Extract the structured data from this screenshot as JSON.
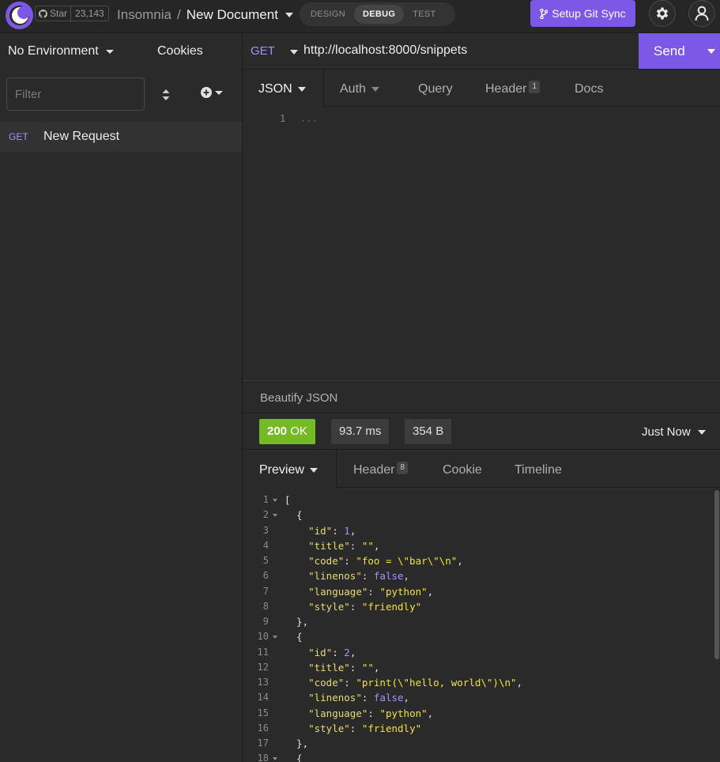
{
  "app": {
    "github_star_label": "Star",
    "github_star_count": "23,143",
    "breadcrumb_app": "Insomnia",
    "breadcrumb_separator": "/",
    "breadcrumb_document": "New Document",
    "modes": [
      "DESIGN",
      "DEBUG",
      "TEST"
    ],
    "active_mode": "DEBUG",
    "git_sync_label": "Setup Git Sync",
    "accent_color": "#7b59e6"
  },
  "sidebar": {
    "environment_label": "No Environment",
    "cookies_label": "Cookies",
    "filter_placeholder": "Filter",
    "requests": [
      {
        "method": "GET",
        "name": "New Request"
      }
    ]
  },
  "request": {
    "method": "GET",
    "url": "http://localhost:8000/snippets",
    "send_label": "Send",
    "tabs": {
      "body": "JSON",
      "auth": "Auth",
      "query": "Query",
      "header": "Header",
      "header_count": "1",
      "docs": "Docs"
    },
    "editor_line_number": "1",
    "editor_placeholder": "...",
    "beautify_label": "Beautify JSON"
  },
  "response": {
    "status_code": "200",
    "status_text": "OK",
    "time": "93.7 ms",
    "size": "354 B",
    "history_label": "Just Now",
    "status_color": "#75ba24",
    "tabs": {
      "preview": "Preview",
      "header": "Header",
      "header_count": "8",
      "cookie": "Cookie",
      "timeline": "Timeline"
    },
    "lines": [
      {
        "no": "1",
        "fold": true,
        "text": "["
      },
      {
        "no": "2",
        "fold": true,
        "text": "  {"
      },
      {
        "no": "3",
        "fold": false,
        "text": "    \"id\": 1,"
      },
      {
        "no": "4",
        "fold": false,
        "text": "    \"title\": \"\","
      },
      {
        "no": "5",
        "fold": false,
        "text": "    \"code\": \"foo = \\\"bar\\\"\\n\","
      },
      {
        "no": "6",
        "fold": false,
        "text": "    \"linenos\": false,"
      },
      {
        "no": "7",
        "fold": false,
        "text": "    \"language\": \"python\","
      },
      {
        "no": "8",
        "fold": false,
        "text": "    \"style\": \"friendly\""
      },
      {
        "no": "9",
        "fold": false,
        "text": "  },"
      },
      {
        "no": "10",
        "fold": true,
        "text": "  {"
      },
      {
        "no": "11",
        "fold": false,
        "text": "    \"id\": 2,"
      },
      {
        "no": "12",
        "fold": false,
        "text": "    \"title\": \"\","
      },
      {
        "no": "13",
        "fold": false,
        "text": "    \"code\": \"print(\\\"hello, world\\\")\\n\","
      },
      {
        "no": "14",
        "fold": false,
        "text": "    \"linenos\": false,"
      },
      {
        "no": "15",
        "fold": false,
        "text": "    \"language\": \"python\","
      },
      {
        "no": "16",
        "fold": false,
        "text": "    \"style\": \"friendly\""
      },
      {
        "no": "17",
        "fold": false,
        "text": "  },"
      },
      {
        "no": "18",
        "fold": true,
        "text": "  {"
      }
    ]
  }
}
